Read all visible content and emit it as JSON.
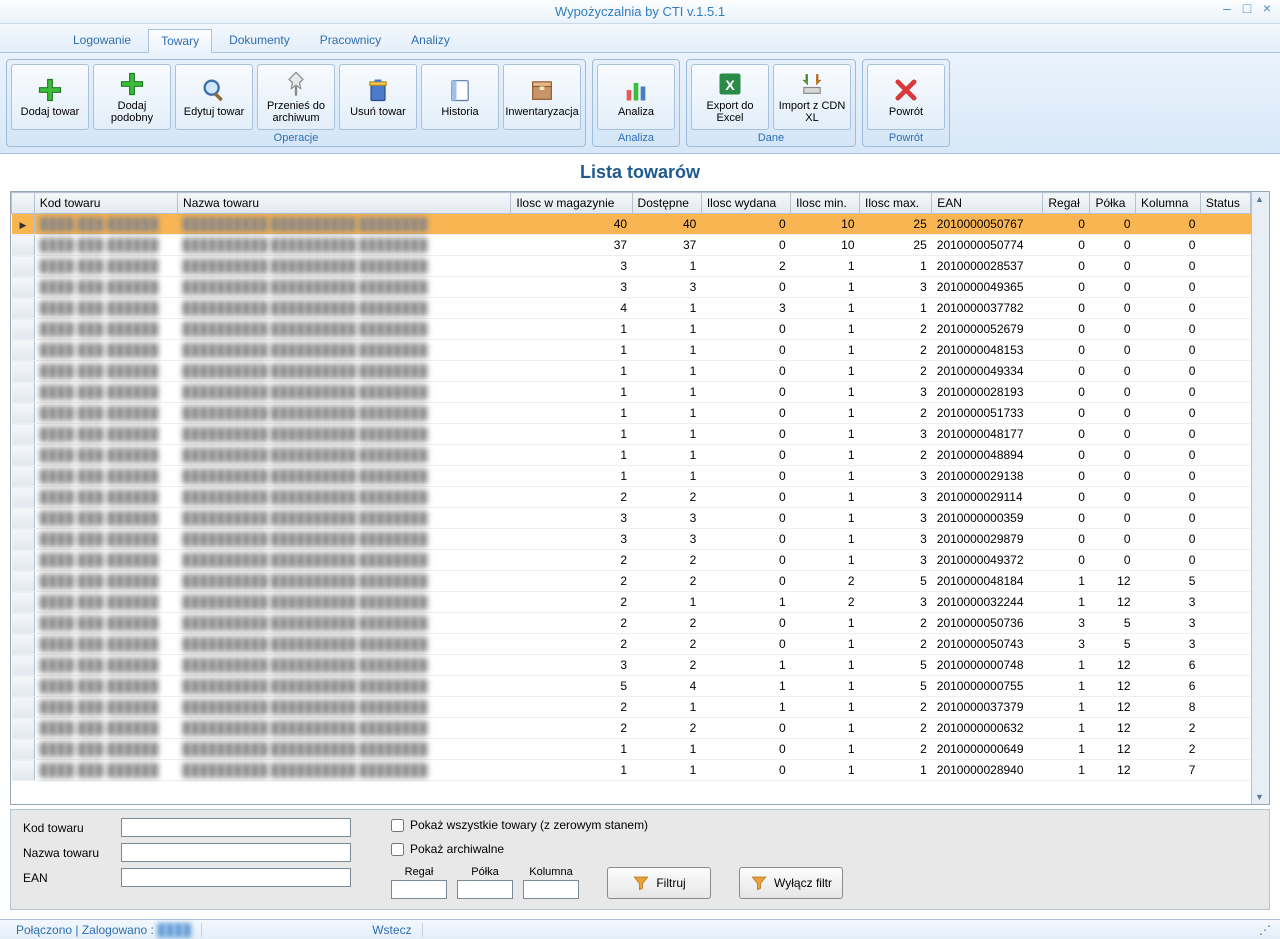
{
  "window": {
    "title": "Wypożyczalnia by CTI v.1.5.1"
  },
  "menu": {
    "items": [
      "Logowanie",
      "Towary",
      "Dokumenty",
      "Pracownicy",
      "Analizy"
    ],
    "active_index": 1
  },
  "ribbon": {
    "groups": [
      {
        "label": "Operacje",
        "buttons": [
          {
            "id": "add",
            "label": "Dodaj towar",
            "icon": "plus-green"
          },
          {
            "id": "add-sim",
            "label": "Dodaj podobny",
            "icon": "plus-green"
          },
          {
            "id": "edit",
            "label": "Edytuj towar",
            "icon": "magnifier"
          },
          {
            "id": "archive",
            "label": "Przenieś do archiwum",
            "icon": "pin"
          },
          {
            "id": "delete",
            "label": "Usuń towar",
            "icon": "trash"
          },
          {
            "id": "history",
            "label": "Historia",
            "icon": "book"
          },
          {
            "id": "inventory",
            "label": "Inwentaryzacja",
            "icon": "box"
          }
        ]
      },
      {
        "label": "Analiza",
        "buttons": [
          {
            "id": "analysis",
            "label": "Analiza",
            "icon": "bars"
          }
        ]
      },
      {
        "label": "Dane",
        "buttons": [
          {
            "id": "export-xls",
            "label": "Export do Excel",
            "icon": "excel"
          },
          {
            "id": "import-cdn",
            "label": "Import z CDN XL",
            "icon": "import"
          }
        ]
      },
      {
        "label": "Powrót",
        "buttons": [
          {
            "id": "back",
            "label": "Powrót",
            "icon": "x-red"
          }
        ]
      }
    ]
  },
  "page_title": "Lista towarów",
  "grid": {
    "columns": [
      "Kod towaru",
      "Nazwa towaru",
      "Ilosc w magazynie",
      "Dostępne",
      "Ilosc wydana",
      "Ilosc min.",
      "Ilosc max.",
      "EAN",
      "Regał",
      "Półka",
      "Kolumna",
      "Status"
    ],
    "selected_index": 0,
    "rows": [
      {
        "mag": 40,
        "dost": 40,
        "wyd": 0,
        "min": 10,
        "max": 25,
        "ean": "2010000050767",
        "regal": 0,
        "polka": 0,
        "kol": 0
      },
      {
        "mag": 37,
        "dost": 37,
        "wyd": 0,
        "min": 10,
        "max": 25,
        "ean": "2010000050774",
        "regal": 0,
        "polka": 0,
        "kol": 0
      },
      {
        "mag": 3,
        "dost": 1,
        "wyd": 2,
        "min": 1,
        "max": 1,
        "ean": "2010000028537",
        "regal": 0,
        "polka": 0,
        "kol": 0
      },
      {
        "mag": 3,
        "dost": 3,
        "wyd": 0,
        "min": 1,
        "max": 3,
        "ean": "2010000049365",
        "regal": 0,
        "polka": 0,
        "kol": 0
      },
      {
        "mag": 4,
        "dost": 1,
        "wyd": 3,
        "min": 1,
        "max": 1,
        "ean": "2010000037782",
        "regal": 0,
        "polka": 0,
        "kol": 0
      },
      {
        "mag": 1,
        "dost": 1,
        "wyd": 0,
        "min": 1,
        "max": 2,
        "ean": "2010000052679",
        "regal": 0,
        "polka": 0,
        "kol": 0
      },
      {
        "mag": 1,
        "dost": 1,
        "wyd": 0,
        "min": 1,
        "max": 2,
        "ean": "2010000048153",
        "regal": 0,
        "polka": 0,
        "kol": 0
      },
      {
        "mag": 1,
        "dost": 1,
        "wyd": 0,
        "min": 1,
        "max": 2,
        "ean": "2010000049334",
        "regal": 0,
        "polka": 0,
        "kol": 0
      },
      {
        "mag": 1,
        "dost": 1,
        "wyd": 0,
        "min": 1,
        "max": 3,
        "ean": "2010000028193",
        "regal": 0,
        "polka": 0,
        "kol": 0
      },
      {
        "mag": 1,
        "dost": 1,
        "wyd": 0,
        "min": 1,
        "max": 2,
        "ean": "2010000051733",
        "regal": 0,
        "polka": 0,
        "kol": 0
      },
      {
        "mag": 1,
        "dost": 1,
        "wyd": 0,
        "min": 1,
        "max": 3,
        "ean": "2010000048177",
        "regal": 0,
        "polka": 0,
        "kol": 0
      },
      {
        "mag": 1,
        "dost": 1,
        "wyd": 0,
        "min": 1,
        "max": 2,
        "ean": "2010000048894",
        "regal": 0,
        "polka": 0,
        "kol": 0
      },
      {
        "mag": 1,
        "dost": 1,
        "wyd": 0,
        "min": 1,
        "max": 3,
        "ean": "2010000029138",
        "regal": 0,
        "polka": 0,
        "kol": 0
      },
      {
        "mag": 2,
        "dost": 2,
        "wyd": 0,
        "min": 1,
        "max": 3,
        "ean": "2010000029114",
        "regal": 0,
        "polka": 0,
        "kol": 0
      },
      {
        "mag": 3,
        "dost": 3,
        "wyd": 0,
        "min": 1,
        "max": 3,
        "ean": "2010000000359",
        "regal": 0,
        "polka": 0,
        "kol": 0
      },
      {
        "mag": 3,
        "dost": 3,
        "wyd": 0,
        "min": 1,
        "max": 3,
        "ean": "2010000029879",
        "regal": 0,
        "polka": 0,
        "kol": 0
      },
      {
        "mag": 2,
        "dost": 2,
        "wyd": 0,
        "min": 1,
        "max": 3,
        "ean": "2010000049372",
        "regal": 0,
        "polka": 0,
        "kol": 0
      },
      {
        "mag": 2,
        "dost": 2,
        "wyd": 0,
        "min": 2,
        "max": 5,
        "ean": "2010000048184",
        "regal": 1,
        "polka": 12,
        "kol": 5
      },
      {
        "mag": 2,
        "dost": 1,
        "wyd": 1,
        "min": 2,
        "max": 3,
        "ean": "2010000032244",
        "regal": 1,
        "polka": 12,
        "kol": 3
      },
      {
        "mag": 2,
        "dost": 2,
        "wyd": 0,
        "min": 1,
        "max": 2,
        "ean": "2010000050736",
        "regal": 3,
        "polka": 5,
        "kol": 3
      },
      {
        "mag": 2,
        "dost": 2,
        "wyd": 0,
        "min": 1,
        "max": 2,
        "ean": "2010000050743",
        "regal": 3,
        "polka": 5,
        "kol": 3
      },
      {
        "mag": 3,
        "dost": 2,
        "wyd": 1,
        "min": 1,
        "max": 5,
        "ean": "2010000000748",
        "regal": 1,
        "polka": 12,
        "kol": 6
      },
      {
        "mag": 5,
        "dost": 4,
        "wyd": 1,
        "min": 1,
        "max": 5,
        "ean": "2010000000755",
        "regal": 1,
        "polka": 12,
        "kol": 6
      },
      {
        "mag": 2,
        "dost": 1,
        "wyd": 1,
        "min": 1,
        "max": 2,
        "ean": "2010000037379",
        "regal": 1,
        "polka": 12,
        "kol": 8
      },
      {
        "mag": 2,
        "dost": 2,
        "wyd": 0,
        "min": 1,
        "max": 2,
        "ean": "2010000000632",
        "regal": 1,
        "polka": 12,
        "kol": 2
      },
      {
        "mag": 1,
        "dost": 1,
        "wyd": 0,
        "min": 1,
        "max": 2,
        "ean": "2010000000649",
        "regal": 1,
        "polka": 12,
        "kol": 2
      },
      {
        "mag": 1,
        "dost": 1,
        "wyd": 0,
        "min": 1,
        "max": 1,
        "ean": "2010000028940",
        "regal": 1,
        "polka": 12,
        "kol": 7
      }
    ]
  },
  "filter": {
    "labels": {
      "kod": "Kod towaru",
      "nazwa": "Nazwa towaru",
      "ean": "EAN",
      "regal": "Regał",
      "polka": "Półka",
      "kolumna": "Kolumna"
    },
    "checkboxes": {
      "show_zero": "Pokaż wszystkie towary (z zerowym stanem)",
      "show_arch": "Pokaż archiwalne"
    },
    "buttons": {
      "filter": "Filtruj",
      "clear": "Wyłącz filtr"
    }
  },
  "status": {
    "left": "Połączono | Zalogowano :",
    "back": "Wstecz"
  }
}
